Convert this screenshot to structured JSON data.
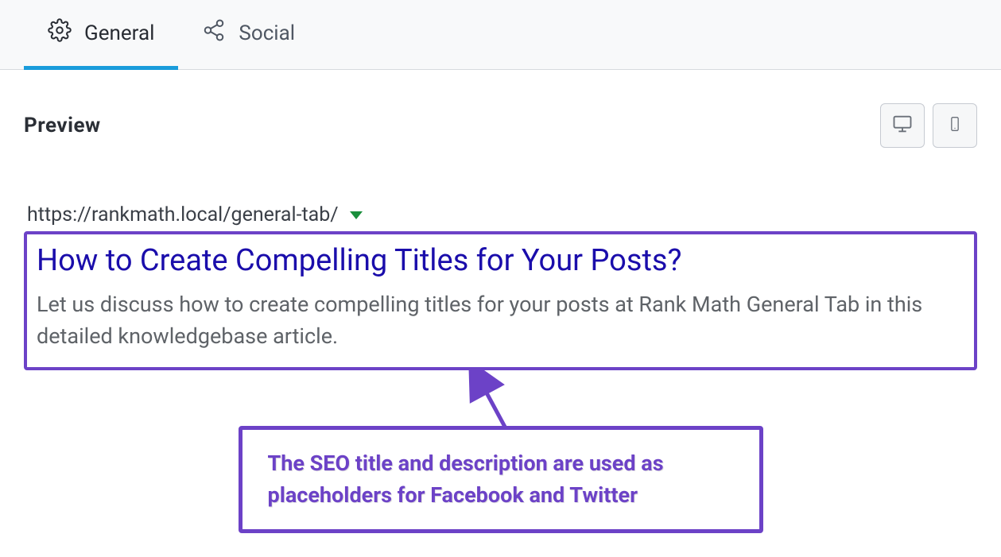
{
  "tabs": {
    "general": "General",
    "social": "Social"
  },
  "preview": {
    "label": "Preview",
    "url": "https://rankmath.local/general-tab/",
    "title": "How to Create Compelling Titles for Your Posts?",
    "description": "Let us discuss how to create compelling titles for your posts at Rank Math General Tab in this detailed knowledgebase article."
  },
  "callout": {
    "text": "The SEO title and description are used as placeholders for Facebook and Twitter"
  }
}
